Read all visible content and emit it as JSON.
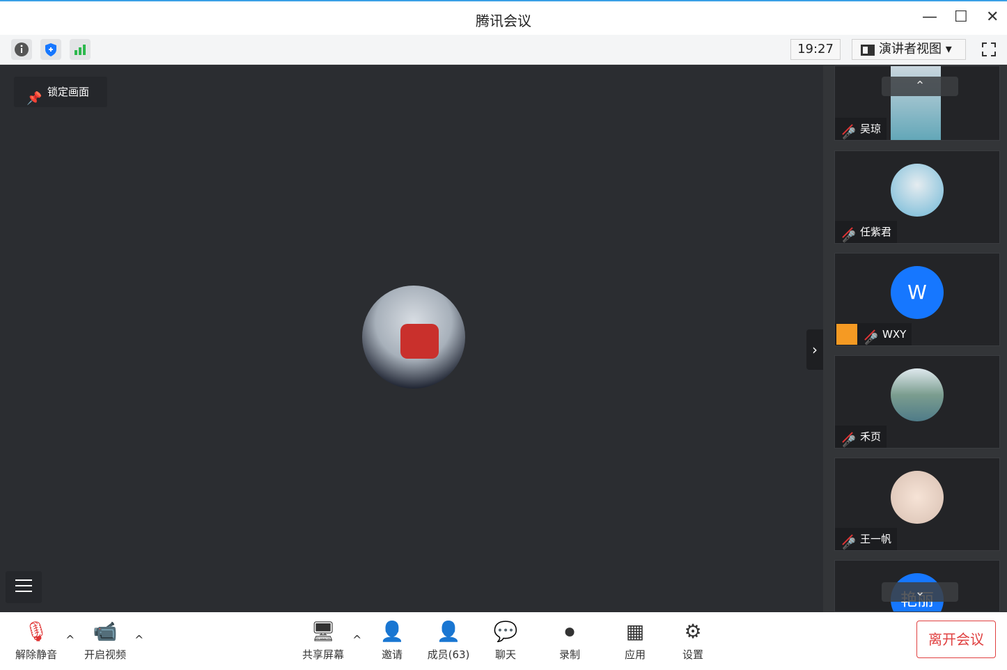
{
  "window": {
    "title": "腾讯会议",
    "minimize": "—",
    "maximize": "☐",
    "close": "✕"
  },
  "statusbar": {
    "time": "19:27",
    "view_label": "演讲者视图",
    "view_arrow": "▾"
  },
  "main": {
    "lock_label": "锁定画面",
    "lock_icon": "pin-icon",
    "collapse_arrow": "›"
  },
  "participants": [
    {
      "name": "吴琼",
      "muted": true,
      "avatar": "photo-woman"
    },
    {
      "name": "任紫君",
      "muted": true,
      "avatar": "anime-girl"
    },
    {
      "name": "WXY",
      "muted": true,
      "avatar_letter": "W",
      "avatar_color": "#1677ff",
      "host_badge": true
    },
    {
      "name": "禾页",
      "muted": true,
      "avatar": "landscape"
    },
    {
      "name": "王一帆",
      "muted": true,
      "avatar": "baby"
    },
    {
      "name": "艳丽",
      "muted": true,
      "avatar_color": "#1677ff"
    }
  ],
  "scroll": {
    "up": "⌃",
    "down": "⌄"
  },
  "toolbar": {
    "unmute": "解除静音",
    "video": "开启视频",
    "share": "共享屏幕",
    "invite": "邀请",
    "members": "成员(63)",
    "chat": "聊天",
    "record": "录制",
    "apps": "应用",
    "settings": "设置",
    "leave": "离开会议",
    "caret": "^"
  },
  "colors": {
    "accent": "#1677ff",
    "danger": "#e04040",
    "signal": "#2db84d"
  }
}
